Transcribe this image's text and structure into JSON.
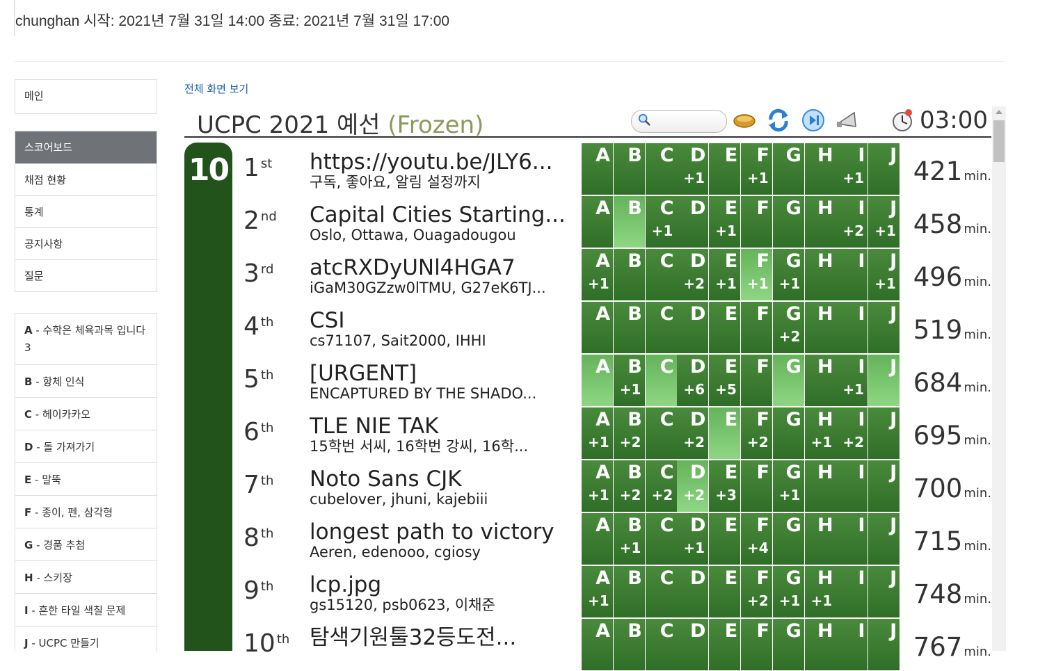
{
  "header": {
    "text": "chunghan 시작: 2021년 7월 31일 14:00 종료: 2021년 7월 31일 17:00"
  },
  "nav": {
    "items": [
      "메인"
    ]
  },
  "menu": {
    "items": [
      "스코어보드",
      "채점 현황",
      "통계",
      "공지사항",
      "질문"
    ],
    "active_index": 0
  },
  "problems": [
    {
      "id": "A",
      "title": " - 수학은 체육과목 입니다 3"
    },
    {
      "id": "B",
      "title": " - 항체 인식"
    },
    {
      "id": "C",
      "title": " - 헤이카카오"
    },
    {
      "id": "D",
      "title": " - 돌 가져가기"
    },
    {
      "id": "E",
      "title": " - 말뚝"
    },
    {
      "id": "F",
      "title": " - 종이, 펜, 삼각형"
    },
    {
      "id": "G",
      "title": " - 경품 추첨"
    },
    {
      "id": "H",
      "title": " - 스키장"
    },
    {
      "id": "I",
      "title": " - 흔한 타일 색칠 문제"
    },
    {
      "id": "J",
      "title": " - UCPC 만들기"
    }
  ],
  "scoreboard": {
    "fullscreen_link": "전체 화면 보기",
    "title": "UCPC 2021 예선",
    "frozen": "(Frozen)",
    "timer": "03:00",
    "solved_count": "10",
    "unit": "min.",
    "letters": [
      "A",
      "B",
      "C",
      "D",
      "E",
      "F",
      "G",
      "H",
      "I",
      "J"
    ],
    "icons": [
      "search-icon",
      "ball-icon",
      "refresh-icon",
      "play-icon",
      "megaphone-icon",
      "clock-icon"
    ],
    "teams": [
      {
        "rank": "1",
        "suffix": "st",
        "name": "https://youtu.be/JLY6...",
        "members": "구독, 좋아요, 알림 설정까지",
        "penalty": "421",
        "attempts": [
          "",
          "",
          "",
          "+1",
          "",
          "+1",
          "",
          "",
          "+1",
          ""
        ],
        "first": []
      },
      {
        "rank": "2",
        "suffix": "nd",
        "name": "Capital Cities Starting...",
        "members": "Oslo, Ottawa, Ouagadougou",
        "penalty": "458",
        "attempts": [
          "",
          "",
          "+1",
          "",
          "+1",
          "",
          "",
          "",
          "+2",
          "+1"
        ],
        "first": [
          1
        ]
      },
      {
        "rank": "3",
        "suffix": "rd",
        "name": "atcRXDyUNl4HGA7",
        "members": "iGaM30GZzw0lTMU, G27eK6TJ...",
        "penalty": "496",
        "attempts": [
          "+1",
          "",
          "",
          "+2",
          "+1",
          "+1",
          "+1",
          "",
          "",
          "+1"
        ],
        "first": [
          5
        ]
      },
      {
        "rank": "4",
        "suffix": "th",
        "name": "CSI",
        "members": "cs71107, Sait2000, IHHI",
        "penalty": "519",
        "attempts": [
          "",
          "",
          "",
          "",
          "",
          "",
          "+2",
          "",
          "",
          ""
        ],
        "first": []
      },
      {
        "rank": "5",
        "suffix": "th",
        "name": "[URGENT]",
        "members": "ENCAPTURED BY THE SHADO...",
        "penalty": "684",
        "attempts": [
          "",
          "+1",
          "",
          "+6",
          "+5",
          "",
          "",
          "",
          "+1",
          ""
        ],
        "first": [
          0,
          2,
          6,
          9
        ]
      },
      {
        "rank": "6",
        "suffix": "th",
        "name": "TLE NIE TAK",
        "members": "15학번 서씨, 16학번 강씨, 16학...",
        "penalty": "695",
        "attempts": [
          "+1",
          "+2",
          "",
          "+2",
          "",
          "+2",
          "",
          "+1",
          "+2",
          ""
        ],
        "first": [
          4
        ]
      },
      {
        "rank": "7",
        "suffix": "th",
        "name": "Noto Sans CJK",
        "members": "cubelover, jhuni, kajebiii",
        "penalty": "700",
        "attempts": [
          "+1",
          "+2",
          "+2",
          "+2",
          "+3",
          "",
          "+1",
          "",
          "",
          ""
        ],
        "first": [
          3
        ]
      },
      {
        "rank": "8",
        "suffix": "th",
        "name": "longest path to victory",
        "members": "Aeren, edenooo, cgiosy",
        "penalty": "715",
        "attempts": [
          "",
          "+1",
          "",
          "+1",
          "",
          "+4",
          "",
          "",
          "",
          ""
        ],
        "first": []
      },
      {
        "rank": "9",
        "suffix": "th",
        "name": "lcp.jpg",
        "members": "gs15120, psb0623, 이채준",
        "penalty": "748",
        "attempts": [
          "+1",
          "",
          "",
          "",
          "",
          "+2",
          "+1",
          "+1",
          "",
          ""
        ],
        "first": []
      },
      {
        "rank": "10",
        "suffix": "th",
        "name": "탐색기원툴32등도전...",
        "members": "",
        "penalty": "767",
        "attempts": [
          "",
          "",
          "",
          "",
          "",
          "",
          "",
          "",
          "",
          ""
        ],
        "first": []
      }
    ]
  }
}
